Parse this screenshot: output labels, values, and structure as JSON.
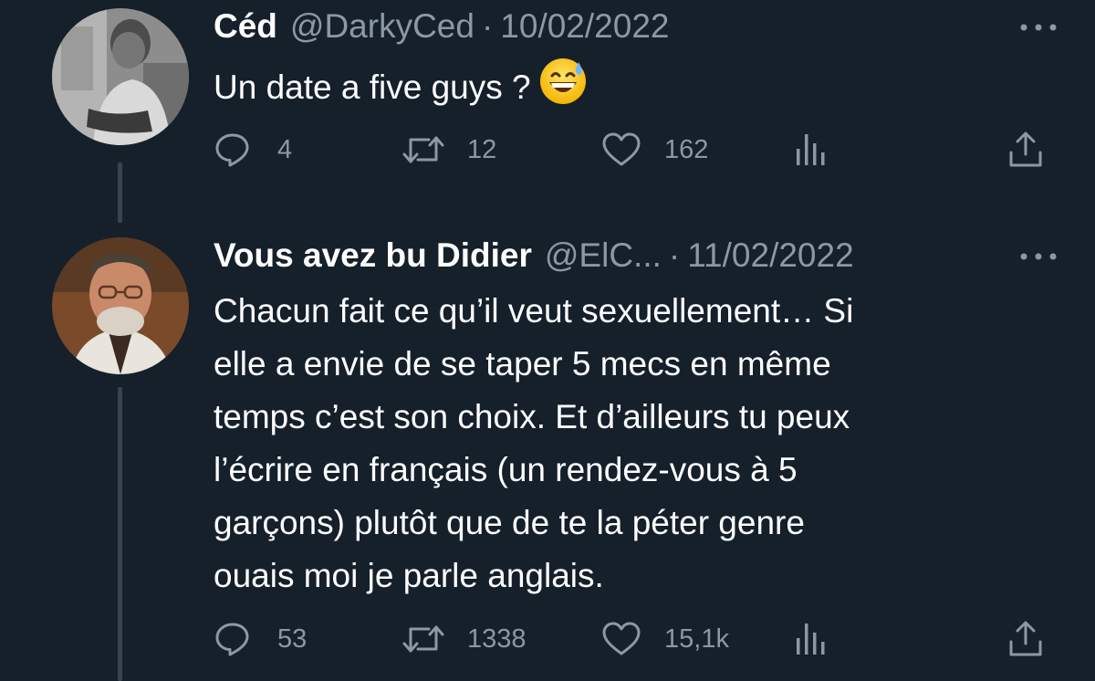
{
  "tweets": [
    {
      "display_name": "Céd",
      "handle": "@DarkyCed",
      "separator": "·",
      "date": "10/02/2022",
      "text": "Un date a five guys ?",
      "emoji": "grinning-face-with-sweat",
      "replies": "4",
      "retweets": "12",
      "likes": "162"
    },
    {
      "display_name": "Vous avez bu Didier",
      "handle": "@ElC...",
      "separator": "·",
      "date": "11/02/2022",
      "text_lines": [
        "Chacun fait ce qu’il veut sexuellement… Si",
        "elle a envie de se taper 5 mecs en même",
        "temps c’est son choix. Et d’ailleurs tu peux",
        "l’écrire en français (un rendez-vous à 5",
        "garçons) plutôt que de te la péter genre",
        "ouais moi je parle anglais."
      ],
      "replies": "53",
      "retweets": "1338",
      "likes": "15,1k"
    }
  ],
  "colors": {
    "background": "#15202b",
    "text_primary": "#ffffff",
    "text_secondary": "#8b98a5",
    "thread_line": "#38444d"
  },
  "icons": [
    "reply-icon",
    "retweet-icon",
    "like-icon",
    "analytics-icon",
    "share-icon",
    "more-options-icon"
  ]
}
